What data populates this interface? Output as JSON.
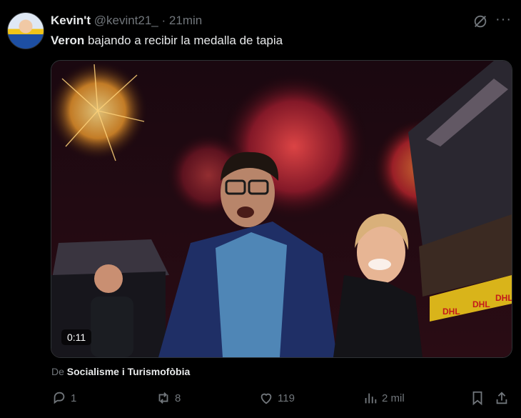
{
  "post": {
    "author_name": "Kevin't",
    "handle": "@kevint21_",
    "separator": "·",
    "time": "21min",
    "text_bold": "Veron",
    "text_rest": " bajando a recibir la medalla de tapia"
  },
  "media": {
    "duration": "0:11",
    "signage": [
      "DHL",
      "DHL",
      "DHL"
    ]
  },
  "source": {
    "prefix": "De",
    "name": "Socialisme i Turismofòbia"
  },
  "actions": {
    "replies": "1",
    "reposts": "8",
    "likes": "119",
    "views": "2 mil"
  },
  "icons": [
    "grok-icon",
    "more-icon",
    "reply-icon",
    "repost-icon",
    "like-icon",
    "views-icon",
    "bookmark-icon",
    "share-icon"
  ]
}
